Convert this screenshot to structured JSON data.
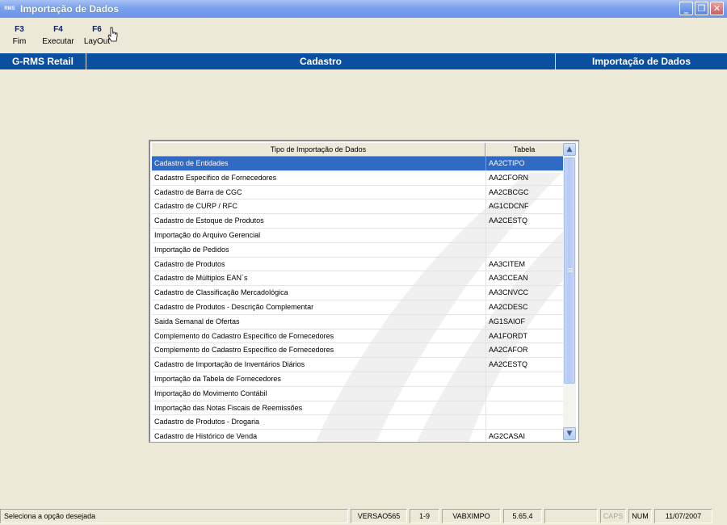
{
  "window": {
    "logo_text": "RMS",
    "title": "Importação de Dados",
    "controls": {
      "minimize": "_",
      "maximize": "❐",
      "close": "✕"
    }
  },
  "toolbar": {
    "keys": [
      {
        "key": "F3",
        "label": "Fim"
      },
      {
        "key": "F4",
        "label": "Executar"
      },
      {
        "key": "F6",
        "label": "LayOut"
      }
    ]
  },
  "header_bar": {
    "left": "G-RMS Retail",
    "center": "Cadastro",
    "right": "Importação de Dados"
  },
  "grid": {
    "columns": [
      "Tipo de Importação de Dados",
      "Tabela"
    ],
    "selected_index": 0,
    "rows": [
      {
        "tipo": "Cadastro de Entidades",
        "tabela": "AA2CTIPO"
      },
      {
        "tipo": "Cadastro Específico de Fornecedores",
        "tabela": "AA2CFORN"
      },
      {
        "tipo": "Cadastro de Barra de CGC",
        "tabela": "AA2CBCGC"
      },
      {
        "tipo": "Cadastro de CURP / RFC",
        "tabela": "AG1CDCNF"
      },
      {
        "tipo": "Cadastro de Estoque de Produtos",
        "tabela": "AA2CESTQ"
      },
      {
        "tipo": "Importação do Arquivo Gerencial",
        "tabela": ""
      },
      {
        "tipo": "Importação de Pedidos",
        "tabela": ""
      },
      {
        "tipo": "Cadastro de Produtos",
        "tabela": "AA3CITEM"
      },
      {
        "tipo": "Cadastro de Múltiplos EAN´s",
        "tabela": "AA3CCEAN"
      },
      {
        "tipo": "Cadastro de Classificação Mercadológica",
        "tabela": "AA3CNVCC"
      },
      {
        "tipo": "Cadastro de Produtos - Descrição Complementar",
        "tabela": "AA2CDESC"
      },
      {
        "tipo": "Saida Semanal de Ofertas",
        "tabela": "AG1SAIOF"
      },
      {
        "tipo": "Complemento do Cadastro Específico de Fornecedores",
        "tabela": "AA1FORDT"
      },
      {
        "tipo": "Complemento do Cadastro Específico de Fornecedores",
        "tabela": "AA2CAFOR"
      },
      {
        "tipo": "Cadastro de Importação de Inventários Diários",
        "tabela": "AA2CESTQ"
      },
      {
        "tipo": "Importação da Tabela de Fornecedores",
        "tabela": ""
      },
      {
        "tipo": "Importação do Movimento Contábil",
        "tabela": ""
      },
      {
        "tipo": "Importação das Notas Fiscais de Reemissões",
        "tabela": ""
      },
      {
        "tipo": "Cadastro de Produtos - Drogaria",
        "tabela": ""
      },
      {
        "tipo": "Cadastro de Histórico de Venda",
        "tabela": "AG2CASAI"
      }
    ],
    "scroll_up": "▲",
    "scroll_down": "▼"
  },
  "statusbar": {
    "message": "Seleciona a opção desejada",
    "version": "VERSAO565",
    "page": "1-9",
    "program": "VABXIMPO",
    "build": "5.65.4",
    "empty": "",
    "caps": "CAPS",
    "num": "NUM",
    "date": "11/07/2007"
  },
  "colors": {
    "title_bar": "#7aa1ec",
    "header_bar": "#0a4fa0",
    "selection": "#316ac5",
    "background": "#ece9d8"
  }
}
